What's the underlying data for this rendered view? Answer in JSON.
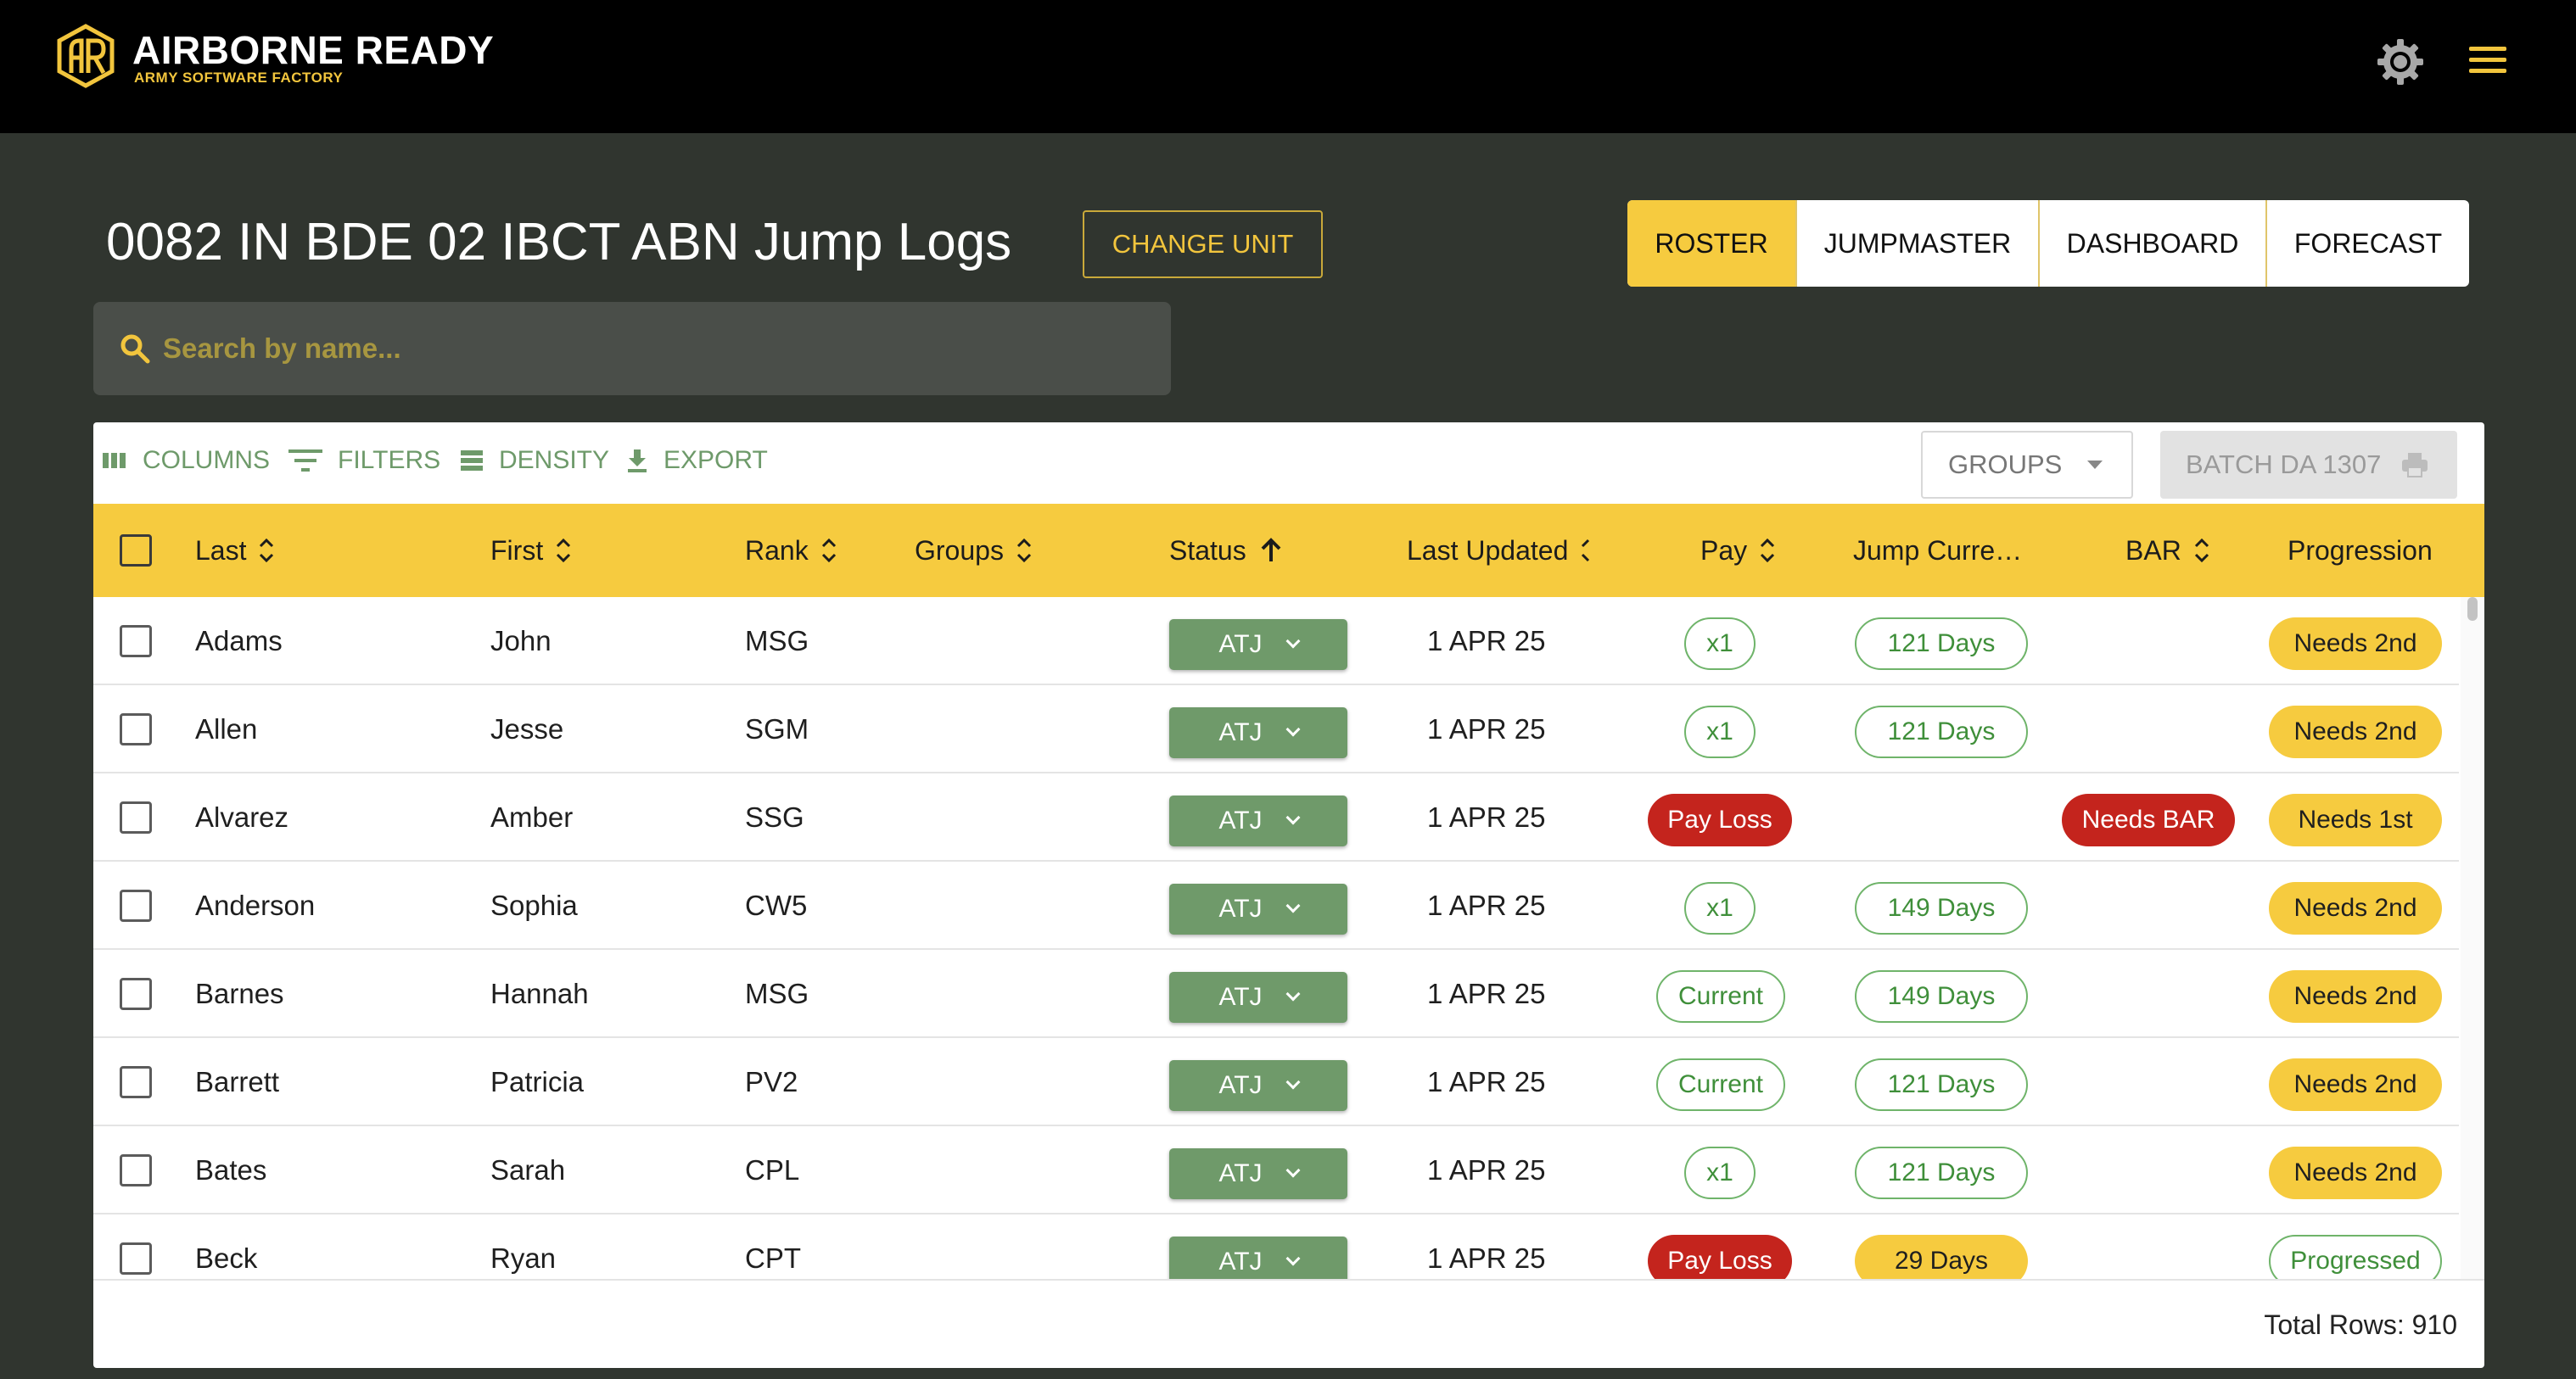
{
  "brand": {
    "title": "AIRBORNE READY",
    "subtitle": "ARMY SOFTWARE FACTORY",
    "accent": "#f2c53d"
  },
  "header": {
    "settings_icon": "gear-icon",
    "menu_icon": "hamburger-icon"
  },
  "page": {
    "title": "0082 IN BDE 02 IBCT ABN Jump Logs",
    "change_unit_label": "CHANGE UNIT"
  },
  "nav": {
    "tabs": [
      {
        "label": "ROSTER",
        "active": true
      },
      {
        "label": "JUMPMASTER",
        "active": false
      },
      {
        "label": "DASHBOARD",
        "active": false
      },
      {
        "label": "FORECAST",
        "active": false
      }
    ]
  },
  "search": {
    "placeholder": "Search by name...",
    "value": ""
  },
  "toolbar": {
    "columns_label": "COLUMNS",
    "filters_label": "FILTERS",
    "density_label": "DENSITY",
    "export_label": "EXPORT",
    "groups_label": "GROUPS",
    "batch_label": "BATCH DA 1307"
  },
  "table": {
    "columns": [
      {
        "label": "Last",
        "sort": "both"
      },
      {
        "label": "First",
        "sort": "both"
      },
      {
        "label": "Rank",
        "sort": "both"
      },
      {
        "label": "Groups",
        "sort": "both"
      },
      {
        "label": "Status",
        "sort": "asc"
      },
      {
        "label": "Last Updated",
        "sort": "both"
      },
      {
        "label": "Pay",
        "sort": "both"
      },
      {
        "label": "Jump Curre…",
        "sort": "none"
      },
      {
        "label": "BAR",
        "sort": "both"
      },
      {
        "label": "Progression",
        "sort": "none"
      }
    ],
    "rows": [
      {
        "last": "Adams",
        "first": "John",
        "rank": "MSG",
        "groups": "",
        "status": "ATJ",
        "updated": "1 APR 25",
        "pay": "x1",
        "pay_style": "outline",
        "jump": "121 Days",
        "jump_style": "outline",
        "bar": "",
        "progression": "Needs 2nd",
        "prog_style": "yellow"
      },
      {
        "last": "Allen",
        "first": "Jesse",
        "rank": "SGM",
        "groups": "",
        "status": "ATJ",
        "updated": "1 APR 25",
        "pay": "x1",
        "pay_style": "outline",
        "jump": "121 Days",
        "jump_style": "outline",
        "bar": "",
        "progression": "Needs 2nd",
        "prog_style": "yellow"
      },
      {
        "last": "Alvarez",
        "first": "Amber",
        "rank": "SSG",
        "groups": "",
        "status": "ATJ",
        "updated": "1 APR 25",
        "pay": "Pay Loss",
        "pay_style": "red",
        "jump": "",
        "jump_style": "",
        "bar": "Needs BAR",
        "progression": "Needs 1st",
        "prog_style": "yellow"
      },
      {
        "last": "Anderson",
        "first": "Sophia",
        "rank": "CW5",
        "groups": "",
        "status": "ATJ",
        "updated": "1 APR 25",
        "pay": "x1",
        "pay_style": "outline",
        "jump": "149 Days",
        "jump_style": "outline",
        "bar": "",
        "progression": "Needs 2nd",
        "prog_style": "yellow"
      },
      {
        "last": "Barnes",
        "first": "Hannah",
        "rank": "MSG",
        "groups": "",
        "status": "ATJ",
        "updated": "1 APR 25",
        "pay": "Current",
        "pay_style": "outline",
        "jump": "149 Days",
        "jump_style": "outline",
        "bar": "",
        "progression": "Needs 2nd",
        "prog_style": "yellow"
      },
      {
        "last": "Barrett",
        "first": "Patricia",
        "rank": "PV2",
        "groups": "",
        "status": "ATJ",
        "updated": "1 APR 25",
        "pay": "Current",
        "pay_style": "outline",
        "jump": "121 Days",
        "jump_style": "outline",
        "bar": "",
        "progression": "Needs 2nd",
        "prog_style": "yellow"
      },
      {
        "last": "Bates",
        "first": "Sarah",
        "rank": "CPL",
        "groups": "",
        "status": "ATJ",
        "updated": "1 APR 25",
        "pay": "x1",
        "pay_style": "outline",
        "jump": "121 Days",
        "jump_style": "outline",
        "bar": "",
        "progression": "Needs 2nd",
        "prog_style": "yellow"
      },
      {
        "last": "Beck",
        "first": "Ryan",
        "rank": "CPT",
        "groups": "",
        "status": "ATJ",
        "updated": "1 APR 25",
        "pay": "Pay Loss",
        "pay_style": "red",
        "jump": "29 Days",
        "jump_style": "yellow",
        "bar": "",
        "progression": "Progressed",
        "prog_style": "outline"
      }
    ]
  },
  "footer": {
    "total_rows": "Total Rows: 910"
  }
}
